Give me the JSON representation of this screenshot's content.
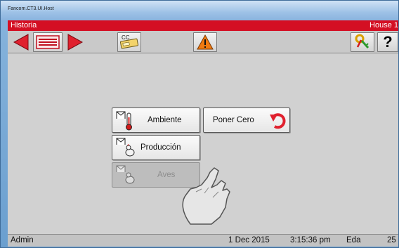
{
  "window": {
    "title": "Fancom.CT3.UI.Host"
  },
  "header": {
    "title": "Historia",
    "house": "House 1"
  },
  "toolbar": {
    "back_icon": "triangle-left-icon",
    "list_icon": "list-card-icon",
    "forward_icon": "triangle-right-icon",
    "cc_label": "CC",
    "warning_icon": "warning-triangle-icon",
    "key_icon": "key-icon",
    "help_label": "?"
  },
  "menu": {
    "ambiente": "Ambiente",
    "poner_cero": "Poner Cero",
    "produccion": "Producción",
    "aves": "Aves"
  },
  "status": {
    "user": "Admin",
    "date": "1 Dec 2015",
    "time": "3:15:36 pm",
    "eda_label": "Eda",
    "eda_value": "25"
  },
  "colors": {
    "header_red": "#d40f23",
    "arrow_red": "#e0202e",
    "warning_orange": "#f07a10"
  }
}
